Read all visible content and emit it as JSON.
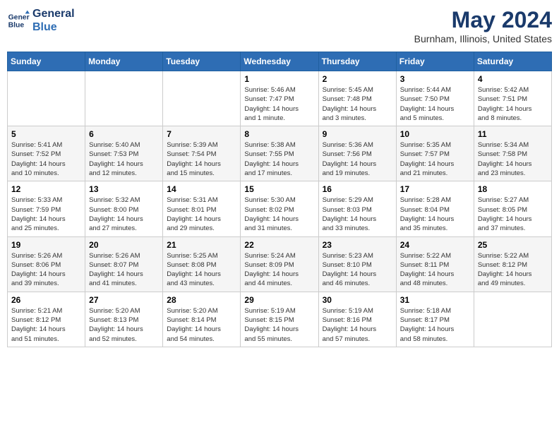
{
  "logo": {
    "line1": "General",
    "line2": "Blue"
  },
  "title": "May 2024",
  "subtitle": "Burnham, Illinois, United States",
  "weekdays": [
    "Sunday",
    "Monday",
    "Tuesday",
    "Wednesday",
    "Thursday",
    "Friday",
    "Saturday"
  ],
  "weeks": [
    [
      {
        "day": "",
        "info": ""
      },
      {
        "day": "",
        "info": ""
      },
      {
        "day": "",
        "info": ""
      },
      {
        "day": "1",
        "info": "Sunrise: 5:46 AM\nSunset: 7:47 PM\nDaylight: 14 hours\nand 1 minute."
      },
      {
        "day": "2",
        "info": "Sunrise: 5:45 AM\nSunset: 7:48 PM\nDaylight: 14 hours\nand 3 minutes."
      },
      {
        "day": "3",
        "info": "Sunrise: 5:44 AM\nSunset: 7:50 PM\nDaylight: 14 hours\nand 5 minutes."
      },
      {
        "day": "4",
        "info": "Sunrise: 5:42 AM\nSunset: 7:51 PM\nDaylight: 14 hours\nand 8 minutes."
      }
    ],
    [
      {
        "day": "5",
        "info": "Sunrise: 5:41 AM\nSunset: 7:52 PM\nDaylight: 14 hours\nand 10 minutes."
      },
      {
        "day": "6",
        "info": "Sunrise: 5:40 AM\nSunset: 7:53 PM\nDaylight: 14 hours\nand 12 minutes."
      },
      {
        "day": "7",
        "info": "Sunrise: 5:39 AM\nSunset: 7:54 PM\nDaylight: 14 hours\nand 15 minutes."
      },
      {
        "day": "8",
        "info": "Sunrise: 5:38 AM\nSunset: 7:55 PM\nDaylight: 14 hours\nand 17 minutes."
      },
      {
        "day": "9",
        "info": "Sunrise: 5:36 AM\nSunset: 7:56 PM\nDaylight: 14 hours\nand 19 minutes."
      },
      {
        "day": "10",
        "info": "Sunrise: 5:35 AM\nSunset: 7:57 PM\nDaylight: 14 hours\nand 21 minutes."
      },
      {
        "day": "11",
        "info": "Sunrise: 5:34 AM\nSunset: 7:58 PM\nDaylight: 14 hours\nand 23 minutes."
      }
    ],
    [
      {
        "day": "12",
        "info": "Sunrise: 5:33 AM\nSunset: 7:59 PM\nDaylight: 14 hours\nand 25 minutes."
      },
      {
        "day": "13",
        "info": "Sunrise: 5:32 AM\nSunset: 8:00 PM\nDaylight: 14 hours\nand 27 minutes."
      },
      {
        "day": "14",
        "info": "Sunrise: 5:31 AM\nSunset: 8:01 PM\nDaylight: 14 hours\nand 29 minutes."
      },
      {
        "day": "15",
        "info": "Sunrise: 5:30 AM\nSunset: 8:02 PM\nDaylight: 14 hours\nand 31 minutes."
      },
      {
        "day": "16",
        "info": "Sunrise: 5:29 AM\nSunset: 8:03 PM\nDaylight: 14 hours\nand 33 minutes."
      },
      {
        "day": "17",
        "info": "Sunrise: 5:28 AM\nSunset: 8:04 PM\nDaylight: 14 hours\nand 35 minutes."
      },
      {
        "day": "18",
        "info": "Sunrise: 5:27 AM\nSunset: 8:05 PM\nDaylight: 14 hours\nand 37 minutes."
      }
    ],
    [
      {
        "day": "19",
        "info": "Sunrise: 5:26 AM\nSunset: 8:06 PM\nDaylight: 14 hours\nand 39 minutes."
      },
      {
        "day": "20",
        "info": "Sunrise: 5:26 AM\nSunset: 8:07 PM\nDaylight: 14 hours\nand 41 minutes."
      },
      {
        "day": "21",
        "info": "Sunrise: 5:25 AM\nSunset: 8:08 PM\nDaylight: 14 hours\nand 43 minutes."
      },
      {
        "day": "22",
        "info": "Sunrise: 5:24 AM\nSunset: 8:09 PM\nDaylight: 14 hours\nand 44 minutes."
      },
      {
        "day": "23",
        "info": "Sunrise: 5:23 AM\nSunset: 8:10 PM\nDaylight: 14 hours\nand 46 minutes."
      },
      {
        "day": "24",
        "info": "Sunrise: 5:22 AM\nSunset: 8:11 PM\nDaylight: 14 hours\nand 48 minutes."
      },
      {
        "day": "25",
        "info": "Sunrise: 5:22 AM\nSunset: 8:12 PM\nDaylight: 14 hours\nand 49 minutes."
      }
    ],
    [
      {
        "day": "26",
        "info": "Sunrise: 5:21 AM\nSunset: 8:12 PM\nDaylight: 14 hours\nand 51 minutes."
      },
      {
        "day": "27",
        "info": "Sunrise: 5:20 AM\nSunset: 8:13 PM\nDaylight: 14 hours\nand 52 minutes."
      },
      {
        "day": "28",
        "info": "Sunrise: 5:20 AM\nSunset: 8:14 PM\nDaylight: 14 hours\nand 54 minutes."
      },
      {
        "day": "29",
        "info": "Sunrise: 5:19 AM\nSunset: 8:15 PM\nDaylight: 14 hours\nand 55 minutes."
      },
      {
        "day": "30",
        "info": "Sunrise: 5:19 AM\nSunset: 8:16 PM\nDaylight: 14 hours\nand 57 minutes."
      },
      {
        "day": "31",
        "info": "Sunrise: 5:18 AM\nSunset: 8:17 PM\nDaylight: 14 hours\nand 58 minutes."
      },
      {
        "day": "",
        "info": ""
      }
    ]
  ]
}
